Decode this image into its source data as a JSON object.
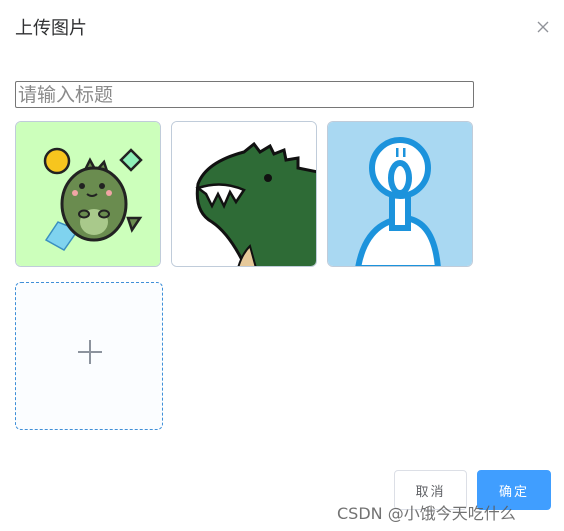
{
  "dialog": {
    "title": "上传图片",
    "close_icon": "close-icon"
  },
  "form": {
    "title_input_placeholder": "请输入标题",
    "title_input_value": ""
  },
  "gallery": {
    "images": [
      {
        "name": "green-dinosaur-sticker",
        "background": "#ccffbb"
      },
      {
        "name": "dinosaur-head-sticker",
        "background": "#ffffff"
      },
      {
        "name": "blue-figure-sticker",
        "background": "#a9d8f2"
      }
    ],
    "upload_icon": "plus-icon"
  },
  "footer": {
    "cancel_label": "取消",
    "confirm_label": "确定"
  },
  "watermark": "CSDN @小饿今天吃什么",
  "colors": {
    "primary": "#409eff",
    "upload_border": "#3f8fd8",
    "thumb_border": "#c0ccda"
  }
}
